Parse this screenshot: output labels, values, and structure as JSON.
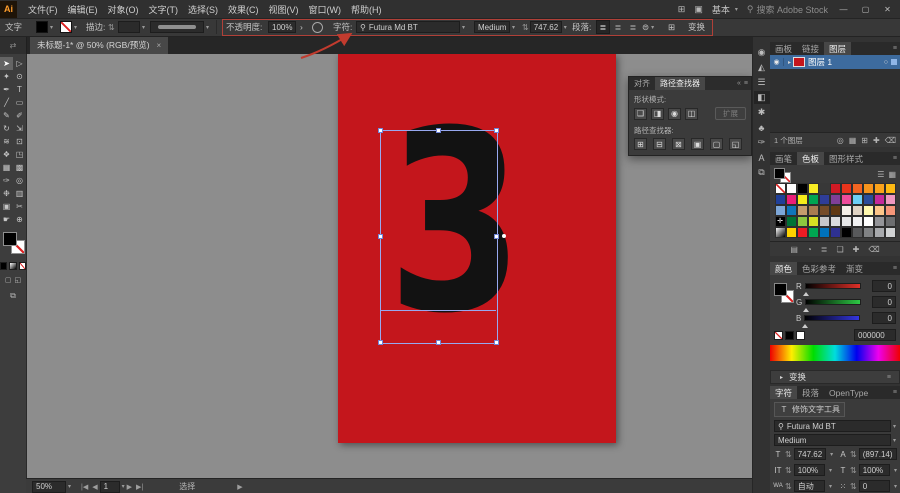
{
  "icons": {
    "chevron_down": "▾",
    "stepper": "⇅",
    "menu": "≡",
    "search": "⚲",
    "close": "✕",
    "minimize": "—",
    "maximize": "▢",
    "close_small": "×",
    "collapse": "«",
    "expand_panels": "⇄",
    "arrange": "⊞",
    "gpu": "▣",
    "opacity_more": "›",
    "glyph_align": "⊜",
    "char_para_toggle": "⊞",
    "artboard_first": "|◀",
    "artboard_prev": "◀",
    "artboard_next": "▶",
    "artboard_last": "▶|",
    "status_expand": "▶",
    "eye": "◉",
    "target": "○",
    "expand_arrow": "▸",
    "list_view": "☰",
    "grid_view": "▦",
    "align_left": "≣",
    "align_center": "≣",
    "align_right": "≣"
  },
  "colors": {
    "artboard_red": "#c4161c",
    "selection_blue": "#97a8f0",
    "annotation_red": "#b04038",
    "layer_row_blue": "#3d6b9e",
    "hex_current": "000000"
  },
  "titlebar": {
    "logo": "Ai",
    "menus": [
      "文件(F)",
      "编辑(E)",
      "对象(O)",
      "文字(T)",
      "选择(S)",
      "效果(C)",
      "视图(V)",
      "窗口(W)",
      "帮助(H)"
    ],
    "workspace": "基本",
    "search_placeholder": "搜索 Adobe Stock"
  },
  "options_bar": {
    "object_label": "文字",
    "stroke_label": "描边:",
    "opacity_label": "不透明度:",
    "opacity_value": "100%",
    "character_label": "字符:",
    "font_name": "Futura Md BT",
    "font_style": "Medium",
    "font_size": "747.62",
    "paragraph_label": "段落:",
    "transform_label": "变换"
  },
  "document_tab": {
    "title": "未标题-1* @ 50% (RGB/预览)"
  },
  "toolbar": {
    "tools": [
      {
        "g": "➤",
        "n": "selection-tool",
        "active": true
      },
      {
        "g": "▷",
        "n": "direct-selection-tool"
      },
      {
        "g": "✦",
        "n": "magic-wand-tool"
      },
      {
        "g": "⊙",
        "n": "lasso-tool"
      },
      {
        "g": "✒",
        "n": "pen-tool"
      },
      {
        "g": "T",
        "n": "type-tool"
      },
      {
        "g": "╱",
        "n": "line-segment-tool"
      },
      {
        "g": "▭",
        "n": "rectangle-tool"
      },
      {
        "g": "✎",
        "n": "paintbrush-tool"
      },
      {
        "g": "✐",
        "n": "pencil-tool"
      },
      {
        "g": "↻",
        "n": "rotate-tool"
      },
      {
        "g": "⇲",
        "n": "scale-tool"
      },
      {
        "g": "≋",
        "n": "width-tool"
      },
      {
        "g": "⊡",
        "n": "free-transform-tool"
      },
      {
        "g": "❖",
        "n": "shape-builder-tool"
      },
      {
        "g": "◳",
        "n": "perspective-grid-tool"
      },
      {
        "g": "▦",
        "n": "mesh-tool"
      },
      {
        "g": "▩",
        "n": "gradient-tool"
      },
      {
        "g": "✑",
        "n": "eyedropper-tool"
      },
      {
        "g": "◎",
        "n": "blend-tool"
      },
      {
        "g": "❉",
        "n": "symbol-sprayer-tool"
      },
      {
        "g": "▥",
        "n": "column-graph-tool"
      },
      {
        "g": "▣",
        "n": "artboard-tool"
      },
      {
        "g": "✂",
        "n": "slice-tool"
      },
      {
        "g": "☛",
        "n": "hand-tool"
      },
      {
        "g": "⊕",
        "n": "zoom-tool"
      }
    ]
  },
  "canvas": {
    "selected_glyph": "3"
  },
  "pathfinder_panel": {
    "tabs": [
      "对齐",
      "路径查找器"
    ],
    "shape_modes_label": "形状模式:",
    "shape_mode_buttons": [
      {
        "g": "❑",
        "n": "unite-button"
      },
      {
        "g": "◨",
        "n": "minus-front-button"
      },
      {
        "g": "◉",
        "n": "intersect-button"
      },
      {
        "g": "◫",
        "n": "exclude-button"
      }
    ],
    "expand_label": "扩展",
    "pathfinder_label": "路径查找器:",
    "pathfinder_buttons": [
      {
        "g": "⊞",
        "n": "divide-button"
      },
      {
        "g": "⊟",
        "n": "trim-button"
      },
      {
        "g": "⊠",
        "n": "merge-button"
      },
      {
        "g": "▣",
        "n": "crop-button"
      },
      {
        "g": "▢",
        "n": "outline-button"
      },
      {
        "g": "◱",
        "n": "minus-back-button"
      }
    ]
  },
  "dock_icons": [
    {
      "g": "◉",
      "n": "color-panel-icon"
    },
    {
      "g": "◭",
      "n": "gradient-panel-icon"
    },
    {
      "g": "☰",
      "n": "align-panel-icon"
    },
    {
      "g": "◧",
      "n": "pathfinder-panel-icon",
      "active": true
    },
    {
      "g": "✱",
      "n": "brushes-panel-icon"
    },
    {
      "g": "♣",
      "n": "symbols-panel-icon"
    },
    {
      "g": "✑",
      "n": "appearance-panel-icon"
    },
    {
      "g": "A",
      "n": "character-styles-panel-icon"
    },
    {
      "g": "⧉",
      "n": "export-panel-icon"
    }
  ],
  "layers_panel": {
    "tabs": [
      "画板",
      "链接",
      "图层"
    ],
    "layer_name": "图层 1",
    "count_label": "1 个图层",
    "bottom_icons": [
      {
        "g": "◎",
        "n": "make-clipping-mask-icon"
      },
      {
        "g": "▦",
        "n": "locate-object-icon"
      },
      {
        "g": "⊞",
        "n": "new-sublayer-icon"
      },
      {
        "g": "✚",
        "n": "new-layer-icon"
      },
      {
        "g": "⌫",
        "n": "delete-layer-icon"
      }
    ]
  },
  "swatches_panel": {
    "tabs": [
      "画笔",
      "色板",
      "图形样式"
    ],
    "grid": [
      "none",
      "#ffffff",
      "#000000",
      "#f8ec24",
      "",
      "#cf1a24",
      "#e8341c",
      "#f26522",
      "#f7941d",
      "#faa21b",
      "#fdb913",
      "#20409a",
      "#ec1e79",
      "#f5eb1a",
      "#00a551",
      "#2e3d98",
      "#7f3f97",
      "#ed4c9b",
      "#6dcff6",
      "#2a4d9b",
      "#c5299b",
      "#ef98c0",
      "#7da7d8",
      "#0f75bb",
      "#c69c6d",
      "#a97c50",
      "#754c28",
      "#603913",
      "#f4f0e8",
      "#e0d4c4",
      "#fff9ae",
      "#fdc689",
      "#f69679",
      "reg",
      "#007236",
      "#8dc63f",
      "#d7df23",
      "#c7c8ca",
      "#dcddde",
      "#e6e7e8",
      "#f1f1f2",
      "#ffffff",
      "#949599",
      "#6d6e70",
      "grad",
      "#ffd200",
      "#ed1c24",
      "#00a651",
      "#0072bc",
      "#2e3192",
      "#000000",
      "#58595b",
      "#808284",
      "#a7a9ac",
      "#d1d3d4"
    ],
    "bottom_icons": [
      {
        "g": "▤",
        "n": "swatch-libraries-icon"
      },
      {
        "g": "◔",
        "n": "color-themes-icon"
      },
      {
        "g": "≣",
        "n": "swatch-kinds-icon"
      },
      {
        "g": "❏",
        "n": "new-color-group-icon"
      },
      {
        "g": "✚",
        "n": "new-swatch-icon"
      },
      {
        "g": "⌫",
        "n": "delete-swatch-icon"
      }
    ]
  },
  "color_panel": {
    "tabs": [
      "颜色",
      "色彩参考",
      "渐变"
    ],
    "sliders": [
      {
        "label": "R",
        "value": "0"
      },
      {
        "label": "G",
        "value": "0"
      },
      {
        "label": "B",
        "value": "0"
      }
    ],
    "hex_value": "000000"
  },
  "transform_panel": {
    "title": "变换"
  },
  "character_panel": {
    "tabs": [
      "字符",
      "段落",
      "OpenType"
    ],
    "touch_type_label": "修饰文字工具",
    "touch_type_icon": "T",
    "font_name": "Futura Md BT",
    "font_style": "Medium",
    "size_icon": "T",
    "size": "747.62",
    "leading_icon": "A",
    "leading": "(897.14)",
    "v_scale_icon": "IT",
    "v_scale": "100%",
    "h_scale_icon": "T",
    "h_scale": "100%",
    "kerning_icon": "WA",
    "kerning": "自动",
    "tracking_icon": "⁙",
    "tracking": "0"
  },
  "status_bar": {
    "zoom": "50%",
    "artboard_number": "1",
    "tool_label": "选择"
  }
}
